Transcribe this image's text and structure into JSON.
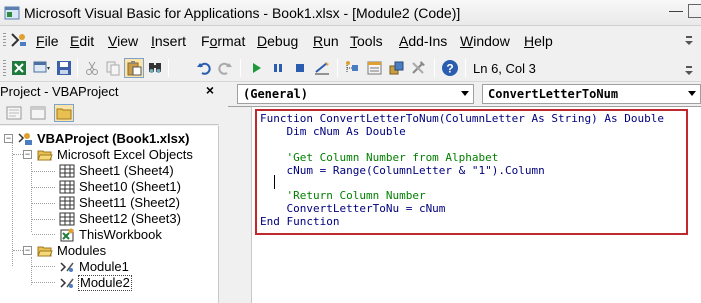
{
  "window": {
    "title": "Microsoft Visual Basic for Applications - Book1.xlsx - [Module2 (Code)]",
    "minimize_glyph": "—"
  },
  "menu": {
    "items": [
      {
        "label_u": "F",
        "label_rest": "ile"
      },
      {
        "label_u": "E",
        "label_rest": "dit"
      },
      {
        "label_u": "V",
        "label_rest": "iew"
      },
      {
        "label_u": "I",
        "label_rest": "nsert"
      },
      {
        "label_pre": "F",
        "label_u": "o",
        "label_rest": "rmat"
      },
      {
        "label_u": "D",
        "label_rest": "ebug"
      },
      {
        "label_u": "R",
        "label_rest": "un"
      },
      {
        "label_u": "T",
        "label_rest": "ools"
      },
      {
        "label_u": "A",
        "label_rest": "dd-Ins"
      },
      {
        "label_u": "W",
        "label_rest": "indow"
      },
      {
        "label_u": "H",
        "label_rest": "elp"
      }
    ]
  },
  "toolbar": {
    "position_text": "Ln 6, Col 3",
    "icons": [
      "excel-icon",
      "insert-module-icon",
      "save-icon",
      "cut-icon",
      "copy-icon",
      "paste-icon",
      "find-icon",
      "undo-icon",
      "redo-icon",
      "run-icon",
      "break-icon",
      "reset-icon",
      "design-mode-icon",
      "project-explorer-icon",
      "properties-icon",
      "object-browser-icon",
      "toolbox-icon",
      "help-icon"
    ]
  },
  "project_panel": {
    "title": "Project - VBAProject",
    "close_glyph": "×",
    "tree": {
      "root": "VBAProject (Book1.xlsx)",
      "excel_objects_folder": "Microsoft Excel Objects",
      "sheets": [
        "Sheet1 (Sheet4)",
        "Sheet10 (Sheet1)",
        "Sheet11 (Sheet2)",
        "Sheet12 (Sheet3)"
      ],
      "workbook": "ThisWorkbook",
      "modules_folder": "Modules",
      "modules": [
        "Module1",
        "Module2"
      ]
    }
  },
  "code_window": {
    "object_combo": "(General)",
    "procedure_combo": "ConvertLetterToNum",
    "lines": [
      "Function ConvertLetterToNum(ColumnLetter As String) As Double",
      "    Dim cNum As Double",
      "",
      "    'Get Column Number from Alphabet",
      "    cNum = Range(ColumnLetter & \"1\").Column",
      "",
      "    'Return Column Number",
      "    ConvertLetterToNu = cNum",
      "End Function"
    ],
    "highlight_color": "#c0282d",
    "keyword_color": "#00007f",
    "comment_color": "#007f00"
  }
}
